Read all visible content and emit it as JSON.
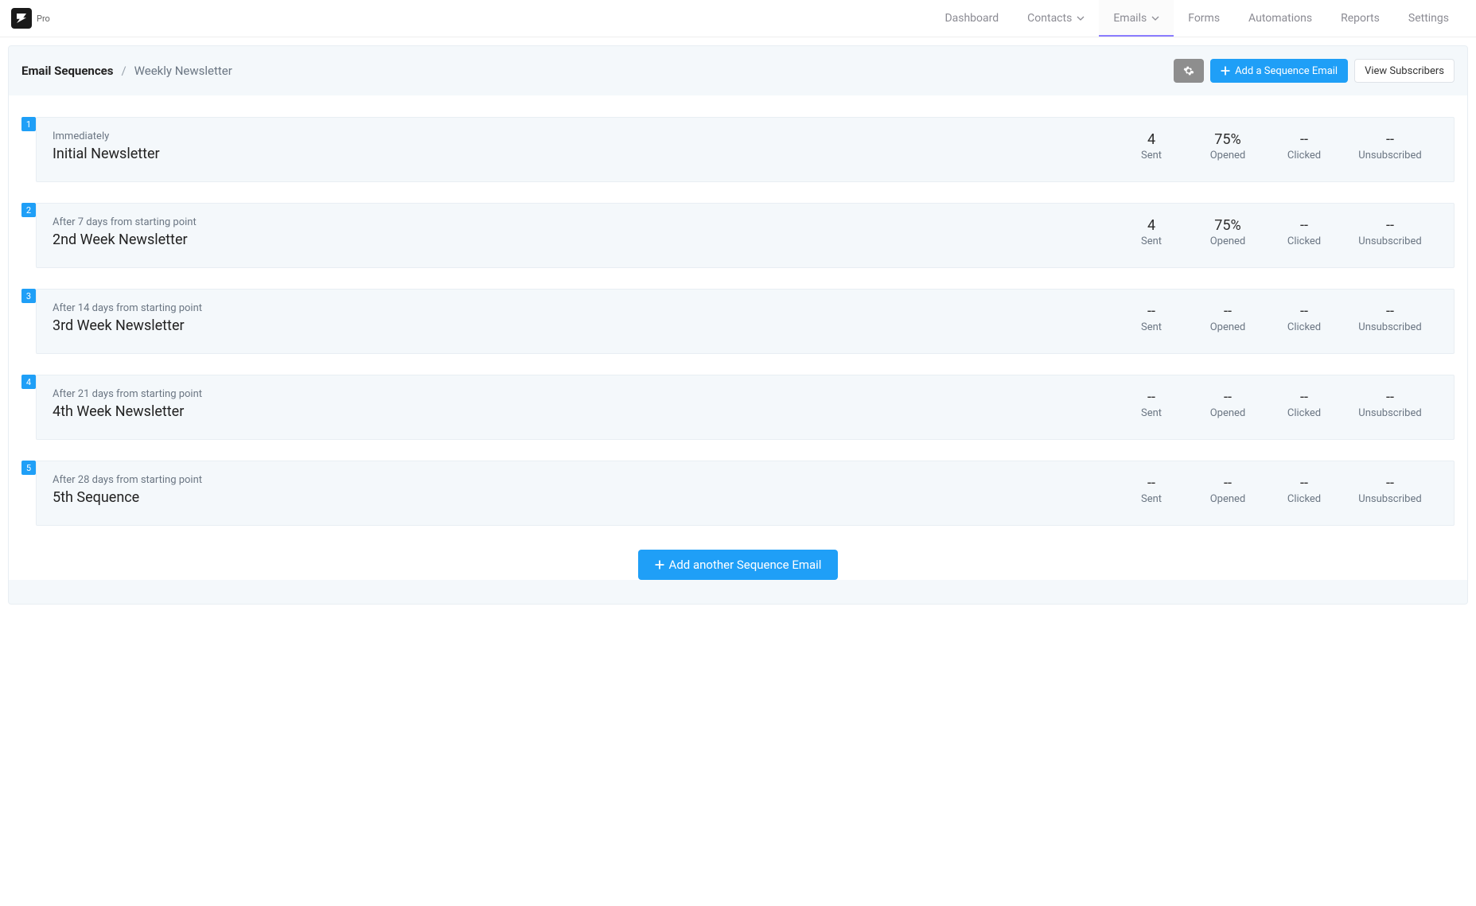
{
  "brand": {
    "tag": "Pro"
  },
  "nav": {
    "items": [
      {
        "label": "Dashboard",
        "dropdown": false,
        "active": false
      },
      {
        "label": "Contacts",
        "dropdown": true,
        "active": false
      },
      {
        "label": "Emails",
        "dropdown": true,
        "active": true
      },
      {
        "label": "Forms",
        "dropdown": false,
        "active": false
      },
      {
        "label": "Automations",
        "dropdown": false,
        "active": false
      },
      {
        "label": "Reports",
        "dropdown": false,
        "active": false
      },
      {
        "label": "Settings",
        "dropdown": false,
        "active": false
      }
    ]
  },
  "header": {
    "crumb_root": "Email Sequences",
    "crumb_sep": "/",
    "crumb_leaf": "Weekly Newsletter",
    "add_label": "Add a Sequence Email",
    "view_label": "View Subscribers"
  },
  "stat_labels": {
    "sent": "Sent",
    "opened": "Opened",
    "clicked": "Clicked",
    "unsubscribed": "Unsubscribed"
  },
  "sequence": [
    {
      "index": "1",
      "timing": "Immediately",
      "title": "Initial Newsletter",
      "stats": {
        "sent": "4",
        "opened": "75%",
        "clicked": "--",
        "unsubscribed": "--"
      }
    },
    {
      "index": "2",
      "timing": "After 7 days from starting point",
      "title": "2nd Week Newsletter",
      "stats": {
        "sent": "4",
        "opened": "75%",
        "clicked": "--",
        "unsubscribed": "--"
      }
    },
    {
      "index": "3",
      "timing": "After 14 days from starting point",
      "title": "3rd Week Newsletter",
      "stats": {
        "sent": "--",
        "opened": "--",
        "clicked": "--",
        "unsubscribed": "--"
      }
    },
    {
      "index": "4",
      "timing": "After 21 days from starting point",
      "title": "4th Week Newsletter",
      "stats": {
        "sent": "--",
        "opened": "--",
        "clicked": "--",
        "unsubscribed": "--"
      }
    },
    {
      "index": "5",
      "timing": "After 28 days from starting point",
      "title": "5th Sequence",
      "stats": {
        "sent": "--",
        "opened": "--",
        "clicked": "--",
        "unsubscribed": "--"
      }
    }
  ],
  "footer": {
    "add_another_label": "Add another Sequence Email"
  }
}
